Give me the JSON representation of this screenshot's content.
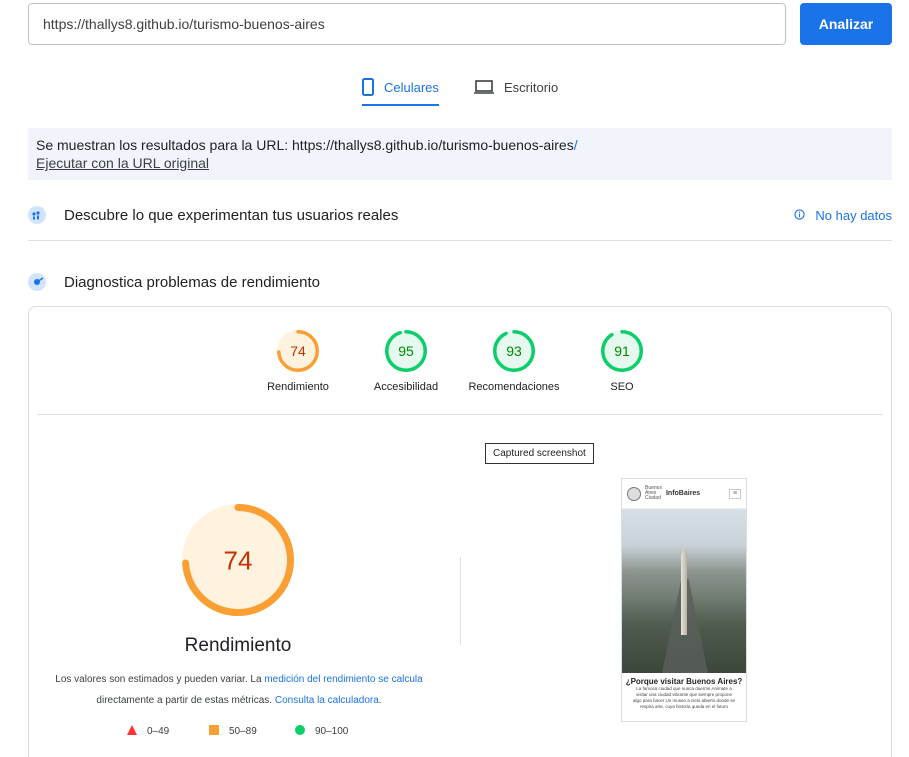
{
  "search": {
    "url_value": "https://thallys8.github.io/turismo-buenos-aires",
    "analyze_label": "Analizar"
  },
  "tabs": {
    "mobile_label": "Celulares",
    "desktop_label": "Escritorio"
  },
  "notice": {
    "prefix": "Se muestran los resultados para la URL: ",
    "final_url": "https://thallys8.github.io/turismo-buenos-aires",
    "slash": "/",
    "original_link": "Ejecutar con la URL original"
  },
  "field_data": {
    "title": "Descubre lo que experimentan tus usuarios reales",
    "no_data_label": "No hay datos"
  },
  "lab_data": {
    "title": "Diagnostica problemas de rendimiento"
  },
  "scores": [
    {
      "label": "Rendimiento",
      "value": "74",
      "fraction": 0.74,
      "color": "#fa9f34"
    },
    {
      "label": "Accesibilidad",
      "value": "95",
      "fraction": 0.95,
      "color": "#0cce6b"
    },
    {
      "label": "Recomendaciones",
      "value": "93",
      "fraction": 0.93,
      "color": "#0cce6b"
    },
    {
      "label": "SEO",
      "value": "91",
      "fraction": 0.91,
      "color": "#0cce6b"
    }
  ],
  "main_score": {
    "value": "74",
    "fraction": 0.74,
    "label": "Rendimiento"
  },
  "explanation": {
    "text1": "Los valores son estimados y pueden variar. La ",
    "link1": "medición del rendimiento se calcula",
    "text2": " directamente a partir de estas métricas. ",
    "link2": "Consulta la calculadora",
    "text3": "."
  },
  "legend": {
    "bad": "0–49",
    "average": "50–89",
    "good": "90–100"
  },
  "screenshot": {
    "tooltip": "Captured screenshot",
    "logo_text_1": "Buenos",
    "logo_text_2": "Aires",
    "logo_text_3": "Ciudad",
    "brand": "InfoBaires",
    "menu_glyph": "≡",
    "heading": "¿Porque visitar Buenos Aires?",
    "body": "La famosa ciudad que nunca duerme Animate a visitar una ciudad vibrante que siempre propone algo para hacer Un museo a cielo abierto donde se respira arte, cuya historia queda en el futuro"
  },
  "colors": {
    "accent": "#1a73e8",
    "average": "#fa9f34",
    "good": "#0cce6b",
    "bad": "#ff3333"
  }
}
